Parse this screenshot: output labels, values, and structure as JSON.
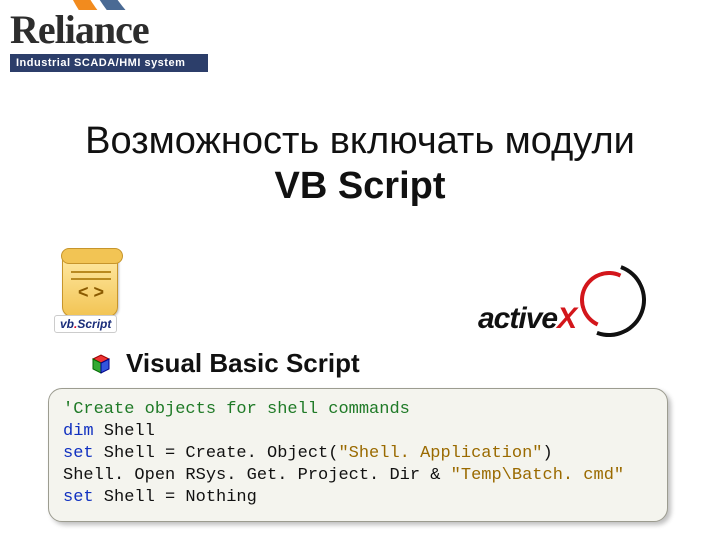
{
  "logo": {
    "word": "Reliance",
    "subtitle": "Industrial SCADA/HMI system"
  },
  "heading": {
    "line1": "Возможность включать модули",
    "line2": "VB Script"
  },
  "vbscript_badge": {
    "vb": "vb",
    "dot": ".",
    "script": "Script"
  },
  "activex": {
    "part1": "active",
    "part2": "X"
  },
  "subtitle": "Visual Basic Script",
  "code": {
    "l1_comment": "'Create objects for shell commands",
    "l2_kw": "dim",
    "l2_rest": " Shell",
    "l3_kw": "set",
    "l3_mid": " Shell = Create. Object(",
    "l3_str": "\"Shell. Application\"",
    "l3_end": ")",
    "l4_a": "Shell. Open ",
    "l4_b": "RSys. Get. Project. Dir ",
    "l4_c": "& ",
    "l4_str": "\"Temp\\Batch. cmd\"",
    "l5_kw": "set",
    "l5_rest": " Shell = Nothing"
  }
}
